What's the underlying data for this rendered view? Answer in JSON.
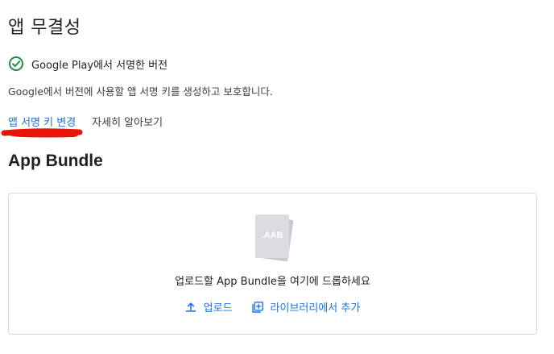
{
  "section": {
    "title": "앱 무결성"
  },
  "signing": {
    "status_icon": "check-circle-icon",
    "status_text": "Google Play에서 서명한 버전",
    "description": "Google에서 버전에 사용할 앱 서명 키를 생성하고 보호합니다.",
    "change_key_label": "앱 서명 키 변경",
    "learn_more_label": "자세히 알아보기"
  },
  "bundle": {
    "title": "App Bundle",
    "file_icon_label": ".AAB",
    "drop_text": "업로드할 App Bundle을 여기에 드롭하세요",
    "upload_label": "업로드",
    "upload_icon": "upload-icon",
    "add_library_label": "라이브러리에서 추가",
    "add_library_icon": "library-add-icon"
  },
  "colors": {
    "accent": "#1a73e8",
    "success": "#1e8e3e",
    "annotation": "#e8150d",
    "border": "#dadce0"
  }
}
